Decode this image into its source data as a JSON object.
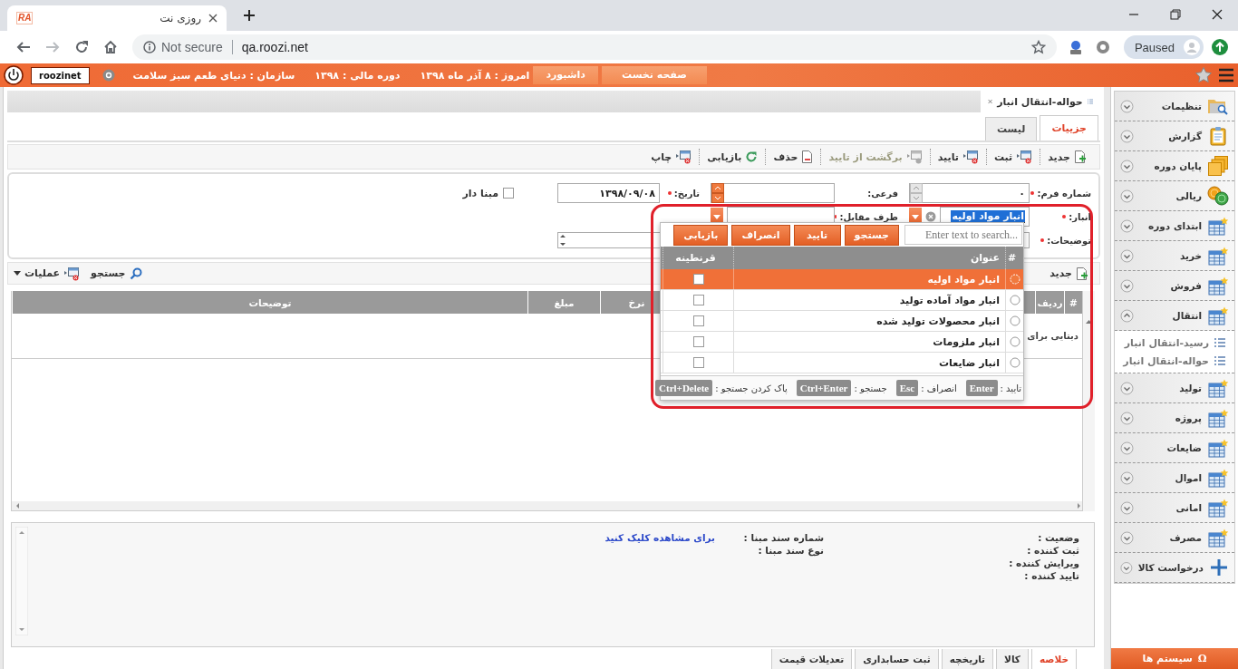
{
  "browser": {
    "tab": {
      "favicon_text": "RA",
      "title": "روزی نت"
    },
    "address": {
      "security": "Not secure",
      "url": "qa.roozi.net"
    },
    "profile": {
      "label": "Paused"
    }
  },
  "header": {
    "user": "roozinet",
    "buttons": [
      "صفحه نخست",
      "داشبورد"
    ],
    "infos": [
      "امروز : ۸ آذر ماه ۱۳۹۸",
      "دوره مالی : ۱۳۹۸",
      "سازمان : دنیای طعم سبز سلامت"
    ]
  },
  "page_tab": {
    "title": "حواله-انتقال انبار"
  },
  "view_tabs": [
    {
      "label": "جزییات",
      "selected": true
    },
    {
      "label": "لیست",
      "selected": false
    }
  ],
  "toolbar": [
    {
      "label": "جدید",
      "disabled": false
    },
    {
      "label": "ثبت",
      "disabled": false
    },
    {
      "label": "تایید",
      "disabled": false
    },
    {
      "label": "برگشت از تایید",
      "disabled": true
    },
    {
      "label": "حذف",
      "disabled": false
    },
    {
      "label": "بازیابی",
      "disabled": false
    },
    {
      "label": "چاپ",
      "disabled": false
    }
  ],
  "form": {
    "rows": [
      [
        {
          "kind": "spin",
          "label": "شماره فرم:",
          "required": true,
          "value": "۰",
          "disabled": true
        },
        {
          "kind": "spin",
          "label": "فرعی:",
          "disabled": false
        },
        {
          "kind": "text",
          "label": "تاریخ:",
          "required": true,
          "value": "۱۳۹۸/۰۹/۰۸"
        },
        {
          "kind": "checkbox",
          "label": "مبنا دار",
          "checked": false
        }
      ],
      [
        {
          "kind": "combo",
          "label": "انبار:",
          "required": true,
          "value": "انبار مواد اولیه"
        },
        {
          "kind": "combo",
          "label": "طرف مقابل:",
          "required": true
        }
      ],
      [
        {
          "kind": "textarea",
          "label": "توضیحات:",
          "required": true
        }
      ]
    ]
  },
  "grid": {
    "toolbar": {
      "new": "جدید",
      "search": "جستجو",
      "actions": "عملیات"
    },
    "columns": [
      "#",
      "ردیف",
      "نرخ",
      "مبلغ",
      "توضیحات"
    ],
    "empty_message": "دیتایی برای"
  },
  "lookup": {
    "search": {
      "placeholder": "Enter text to search..."
    },
    "buttons": [
      "جستجو",
      "تایید",
      "انصراف",
      "بازیابی"
    ],
    "columns": [
      "#",
      "عنوان",
      "قرنطینه"
    ],
    "rows": [
      {
        "title": "انبار مواد اولیه",
        "selected": true,
        "quarantine": false
      },
      {
        "title": "انبار مواد آماده تولید",
        "selected": false,
        "quarantine": false
      },
      {
        "title": "انبار محصولات تولید شده",
        "selected": false,
        "quarantine": false
      },
      {
        "title": "انبار ملزومات",
        "selected": false,
        "quarantine": false
      },
      {
        "title": "انبار ضایعات",
        "selected": false,
        "quarantine": false
      }
    ],
    "hints": [
      {
        "label": "تایید :",
        "key": "Enter"
      },
      {
        "label": "انصراف :",
        "key": "Esc"
      },
      {
        "label": "جستجو :",
        "key": "Ctrl+Enter"
      },
      {
        "label": "پاک کردن جستجو :",
        "key": "Ctrl+Delete"
      }
    ]
  },
  "summary": {
    "status_labels": [
      "وضعیت :",
      "ثبت کننده :",
      "ویرایش کننده :",
      "تایید کننده :"
    ],
    "source_labels": [
      "شماره سند مبنا :",
      "نوع سند مبنا :"
    ],
    "link": "برای مشاهده کلیک کنید"
  },
  "bottom_tabs": [
    {
      "label": "خلاصه",
      "selected": true
    },
    {
      "label": "کالا",
      "selected": false
    },
    {
      "label": "تاریخچه",
      "selected": false
    },
    {
      "label": "ثبت حسابداری",
      "selected": false
    },
    {
      "label": "تعدیلات قیمت",
      "selected": false
    }
  ],
  "sidebar": {
    "items": [
      {
        "label": "تنظیمات",
        "expanded": false
      },
      {
        "label": "گزارش",
        "expanded": false
      },
      {
        "label": "پایان دوره",
        "expanded": false
      },
      {
        "label": "ریالی",
        "expanded": false
      },
      {
        "label": "ابتدای دوره",
        "expanded": false
      },
      {
        "label": "خرید",
        "expanded": false
      },
      {
        "label": "فروش",
        "expanded": false
      },
      {
        "label": "انتقال",
        "expanded": true,
        "children": [
          {
            "label": "رسید-انتقال انبار"
          },
          {
            "label": "حواله-انتقال انبار"
          }
        ]
      },
      {
        "label": "تولید",
        "expanded": false
      },
      {
        "label": "پروژه",
        "expanded": false
      },
      {
        "label": "ضایعات",
        "expanded": false
      },
      {
        "label": "اموال",
        "expanded": false
      },
      {
        "label": "امانی",
        "expanded": false
      },
      {
        "label": "مصرف",
        "expanded": false
      },
      {
        "label": "درخواست کالا",
        "expanded": false
      }
    ],
    "systems": {
      "symbol": "Ω",
      "label": "سیستم ها"
    }
  }
}
